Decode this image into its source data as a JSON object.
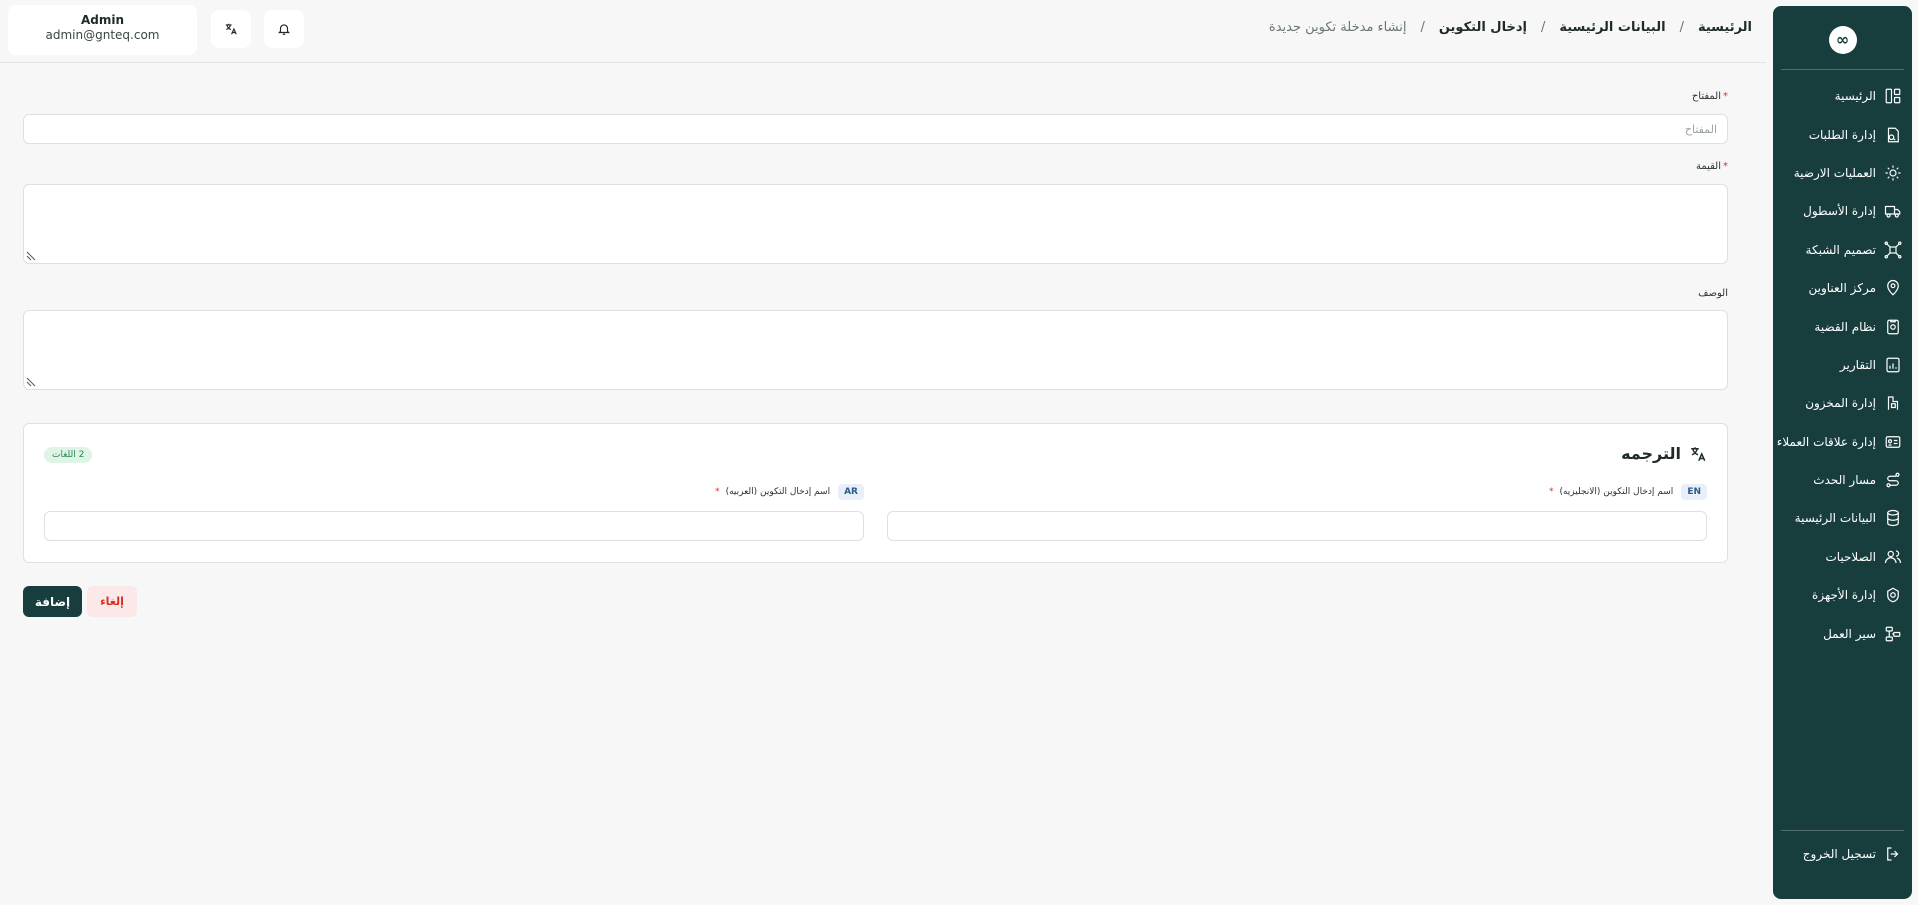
{
  "user": {
    "name": "Admin",
    "email": "admin@gnteq.com"
  },
  "header": {
    "breadcrumb": {
      "home": "الرئيسية",
      "master_data": "البيانات الرئيسية",
      "config_entries": "إدخال التكوين",
      "current": "إنشاء مدخلة تكوين جديدة",
      "separator": "/"
    }
  },
  "sidebar": {
    "logo": "∞",
    "items": [
      {
        "label": "الرئيسية",
        "icon": "dashboard-icon"
      },
      {
        "label": "إدارة الطلبات",
        "icon": "orders-icon"
      },
      {
        "label": "العمليات الارضية",
        "icon": "ground-ops-icon"
      },
      {
        "label": "إدارة الأسطول",
        "icon": "truck-icon"
      },
      {
        "label": "تصميم الشبكة",
        "icon": "network-icon"
      },
      {
        "label": "مركز العناوين",
        "icon": "address-pin-icon"
      },
      {
        "label": "نظام القضية",
        "icon": "case-icon"
      },
      {
        "label": "التقارير",
        "icon": "reports-icon"
      },
      {
        "label": "إدارة المخزون",
        "icon": "inventory-icon"
      },
      {
        "label": "إدارة علاقات العملاء",
        "icon": "crm-icon"
      },
      {
        "label": "مسار الحدث",
        "icon": "event-route-icon"
      },
      {
        "label": "البيانات الرئيسية",
        "icon": "database-icon"
      },
      {
        "label": "الصلاحيات",
        "icon": "users-icon"
      },
      {
        "label": "إدارة الأجهزة",
        "icon": "devices-icon"
      },
      {
        "label": "سير العمل",
        "icon": "workflow-icon"
      }
    ],
    "logout": "تسجيل الخروج"
  },
  "form": {
    "key_label": "المفتاح",
    "key_placeholder": "المفتاح",
    "key_value": "",
    "value_label": "القيمة",
    "description_label": "الوصف",
    "required_mark": "*"
  },
  "translation": {
    "title": "الترجمه",
    "lang_count": "2 اللغات",
    "en": {
      "code": "EN",
      "label": "اسم إدخال التكوين (الانجليزيه)"
    },
    "ar": {
      "code": "AR",
      "label": "اسم إدخال التكوين (العربيه)"
    }
  },
  "actions": {
    "add": "إضافة",
    "cancel": "إلغاء"
  },
  "colors": {
    "sidebar_bg": "#183d3d",
    "primary": "#183d3d",
    "danger": "#d92d20",
    "badge_green": "#2a8a4f"
  }
}
